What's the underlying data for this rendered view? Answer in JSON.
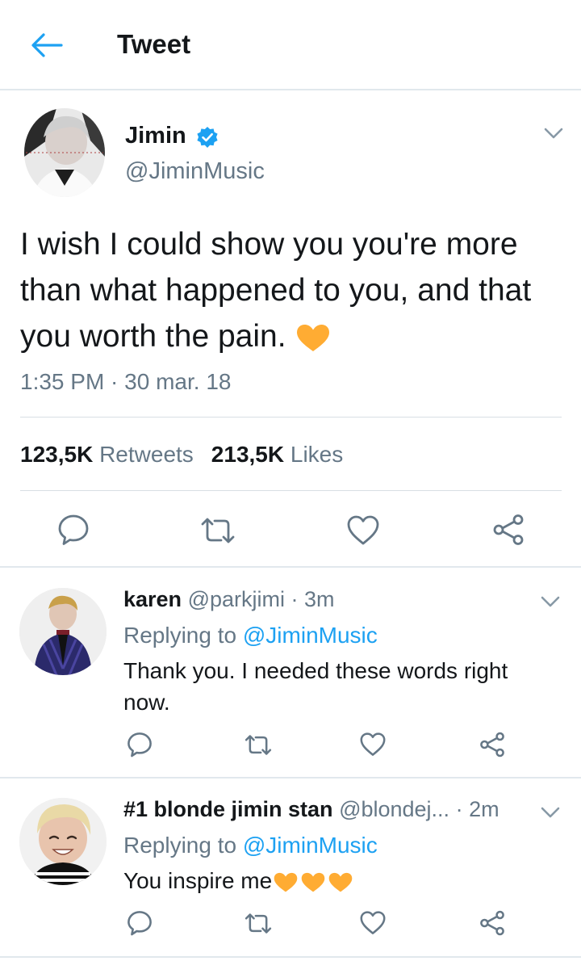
{
  "header": {
    "title": "Tweet",
    "back_icon": "back-arrow-icon"
  },
  "main_tweet": {
    "name": "Jimin",
    "handle": "@JiminMusic",
    "verified": true,
    "text": "I wish I could show you you're more than what happened to you, and that you worth the pain.",
    "emoji": "yellow-heart",
    "timestamp": "1:35 PM · 30 mar. 18",
    "retweets_count": "123,5K",
    "retweets_label": "Retweets",
    "likes_count": "213,5K",
    "likes_label": "Likes"
  },
  "replies": [
    {
      "name": "karen",
      "handle": "@parkjimi",
      "time": "· 3m",
      "replying_prefix": "Replying to",
      "replying_to": "@JiminMusic",
      "text": "Thank you. I needed these words right now."
    },
    {
      "name": "#1 blonde jimin stan",
      "handle": "@blondej...",
      "time": "· 2m",
      "replying_prefix": "Replying to",
      "replying_to": "@JiminMusic",
      "text": "You inspire me"
    }
  ],
  "colors": {
    "accent": "#1da1f2",
    "secondary_text": "#657786",
    "primary_text": "#14171a",
    "divider": "#e1e8ed",
    "heart_yellow": "#ffac33"
  }
}
